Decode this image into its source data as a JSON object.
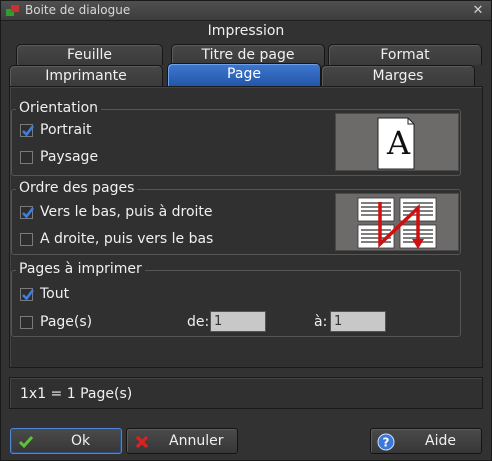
{
  "window": {
    "title": "Boite de dialogue"
  },
  "dialog": {
    "heading": "Impression"
  },
  "tabs": {
    "row_back": [
      "Feuille",
      "Titre de page",
      "Format"
    ],
    "row_front": [
      "Imprimante",
      "Page",
      "Marges"
    ],
    "active": "Page"
  },
  "orientation": {
    "title": "Orientation",
    "portrait": {
      "label": "Portrait",
      "checked": true
    },
    "landscape": {
      "label": "Paysage",
      "checked": false
    },
    "preview_letter": "A"
  },
  "page_order": {
    "title": "Ordre des pages",
    "down_then_right": {
      "label": "Vers le bas, puis à droite",
      "checked": true
    },
    "right_then_down": {
      "label": "A droite, puis vers le bas",
      "checked": false
    }
  },
  "pages_to_print": {
    "title": "Pages à imprimer",
    "all": {
      "label": "Tout",
      "checked": true
    },
    "pages": {
      "label": "Page(s)",
      "checked": false
    },
    "from_label": "de:",
    "from_value": "1",
    "to_label": "à:",
    "to_value": "1"
  },
  "status": {
    "text": "1x1 = 1 Page(s)"
  },
  "buttons": {
    "ok": "Ok",
    "cancel": "Annuler",
    "help": "Aide"
  },
  "colors": {
    "accent": "#2f66bf",
    "check": "#3d7ee0",
    "arrow": "#d01010"
  }
}
